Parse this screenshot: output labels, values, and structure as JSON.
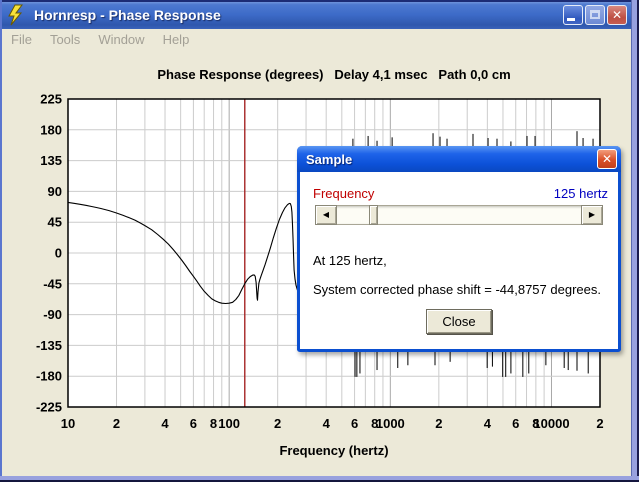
{
  "window": {
    "title": "Hornresp - Phase Response",
    "close_glyph": "✕"
  },
  "menu_bar": {
    "items": [
      "File",
      "Tools",
      "Window",
      "Help"
    ]
  },
  "chart_data": {
    "type": "line",
    "title": "Phase Response (degrees)   Delay 4,1 msec   Path 0,0 cm",
    "xlabel": "Frequency (hertz)",
    "x_scale": "log",
    "xlim": [
      10,
      20000
    ],
    "ylim": [
      -225,
      225
    ],
    "grid": true,
    "y_ticks": [
      225,
      180,
      135,
      90,
      45,
      0,
      -45,
      -90,
      -135,
      -180,
      -225
    ],
    "x_ticks": [
      [
        10,
        "10"
      ],
      [
        20,
        "2"
      ],
      [
        40,
        "4"
      ],
      [
        60,
        "6"
      ],
      [
        80,
        "8"
      ],
      [
        100,
        "100"
      ],
      [
        200,
        "2"
      ],
      [
        400,
        "4"
      ],
      [
        600,
        "6"
      ],
      [
        800,
        "8"
      ],
      [
        1000,
        "1000"
      ],
      [
        2000,
        "2"
      ],
      [
        4000,
        "4"
      ],
      [
        6000,
        "6"
      ],
      [
        8000,
        "8"
      ],
      [
        10000,
        "10000"
      ],
      [
        20000,
        "2"
      ]
    ],
    "cursor_hz": 125,
    "cursor_color": "#a52525",
    "grid_minor_color": "#cccccc",
    "grid_major_color": "#a8a8a8",
    "series": [
      {
        "name": "system-corrected-phase",
        "color": "#000000",
        "points": [
          [
            10,
            74
          ],
          [
            11,
            72.5
          ],
          [
            12,
            71
          ],
          [
            13,
            69.5
          ],
          [
            14,
            68
          ],
          [
            15,
            66.5
          ],
          [
            16,
            65
          ],
          [
            18,
            62
          ],
          [
            20,
            58.5
          ],
          [
            22,
            55
          ],
          [
            24,
            51.5
          ],
          [
            26,
            48
          ],
          [
            28,
            44
          ],
          [
            30,
            40
          ],
          [
            33,
            34
          ],
          [
            36,
            27
          ],
          [
            39,
            20
          ],
          [
            42,
            13
          ],
          [
            45,
            5
          ],
          [
            48,
            -3
          ],
          [
            51,
            -11
          ],
          [
            54,
            -19
          ],
          [
            57,
            -27
          ],
          [
            60,
            -34
          ],
          [
            63,
            -41
          ],
          [
            66,
            -48
          ],
          [
            70,
            -56
          ],
          [
            74,
            -62
          ],
          [
            78,
            -67
          ],
          [
            82,
            -70
          ],
          [
            86,
            -72
          ],
          [
            90,
            -73.3
          ],
          [
            95,
            -73.8
          ],
          [
            100,
            -73.4
          ],
          [
            105,
            -72
          ],
          [
            110,
            -68
          ],
          [
            115,
            -62
          ],
          [
            120,
            -53
          ],
          [
            125,
            -44.9
          ],
          [
            130,
            -38.5
          ],
          [
            135,
            -34.5
          ],
          [
            140,
            -32.3
          ],
          [
            143,
            -32
          ],
          [
            145,
            -34
          ],
          [
            147,
            -43
          ],
          [
            149,
            -66
          ],
          [
            150,
            -69
          ],
          [
            151,
            -57
          ],
          [
            153,
            -44
          ],
          [
            155,
            -39
          ],
          [
            158,
            -33
          ],
          [
            162,
            -26
          ],
          [
            167,
            -17
          ],
          [
            173,
            -6
          ],
          [
            180,
            7
          ],
          [
            188,
            22
          ],
          [
            196,
            36
          ],
          [
            205,
            49
          ],
          [
            214,
            59
          ],
          [
            222,
            66
          ],
          [
            230,
            70.5
          ],
          [
            236,
            72.5
          ],
          [
            240,
            72
          ],
          [
            243,
            68
          ],
          [
            245,
            60
          ],
          [
            247,
            45
          ],
          [
            249,
            22
          ],
          [
            251,
            -5
          ],
          [
            253,
            -25
          ],
          [
            256,
            -38
          ],
          [
            260,
            -47
          ],
          [
            266,
            -55
          ],
          [
            272,
            -62
          ]
        ]
      }
    ],
    "wrap_spikes_top": [
      [
        586,
        167
      ],
      [
        728,
        171
      ],
      [
        827,
        164
      ],
      [
        1026,
        169
      ],
      [
        1841,
        175
      ],
      [
        2034,
        170
      ],
      [
        2248,
        167
      ],
      [
        3258,
        174
      ],
      [
        4040,
        168
      ],
      [
        4592,
        167
      ],
      [
        5600,
        163
      ],
      [
        7048,
        171
      ],
      [
        7907,
        171
      ],
      [
        14400,
        178
      ],
      [
        15700,
        168
      ],
      [
        18110,
        167
      ]
    ],
    "wrap_spikes_bottom": [
      [
        604,
        -181
      ],
      [
        620,
        -181
      ],
      [
        648,
        -176
      ],
      [
        827,
        -171
      ],
      [
        1112,
        -168
      ],
      [
        1285,
        -164
      ],
      [
        1893,
        -164
      ],
      [
        2350,
        -159
      ],
      [
        3990,
        -168
      ],
      [
        4300,
        -166
      ],
      [
        4980,
        -181
      ],
      [
        5200,
        -181
      ],
      [
        5600,
        -176
      ],
      [
        6640,
        -181
      ],
      [
        7230,
        -176
      ],
      [
        9230,
        -164
      ],
      [
        11990,
        -168
      ],
      [
        12700,
        -171
      ],
      [
        14400,
        -172
      ],
      [
        16900,
        -176
      ]
    ]
  },
  "dialog": {
    "title": "Sample",
    "close_glyph": "✕",
    "frequency_label": "Frequency",
    "frequency_value": "125 hertz",
    "scrollbar": {
      "left_arrow_glyph": "◀",
      "right_arrow_glyph": "▶"
    },
    "line1": "At 125 hertz,",
    "line2": "System corrected phase shift = -44,8757 degrees.",
    "close_button_label": "Close"
  }
}
